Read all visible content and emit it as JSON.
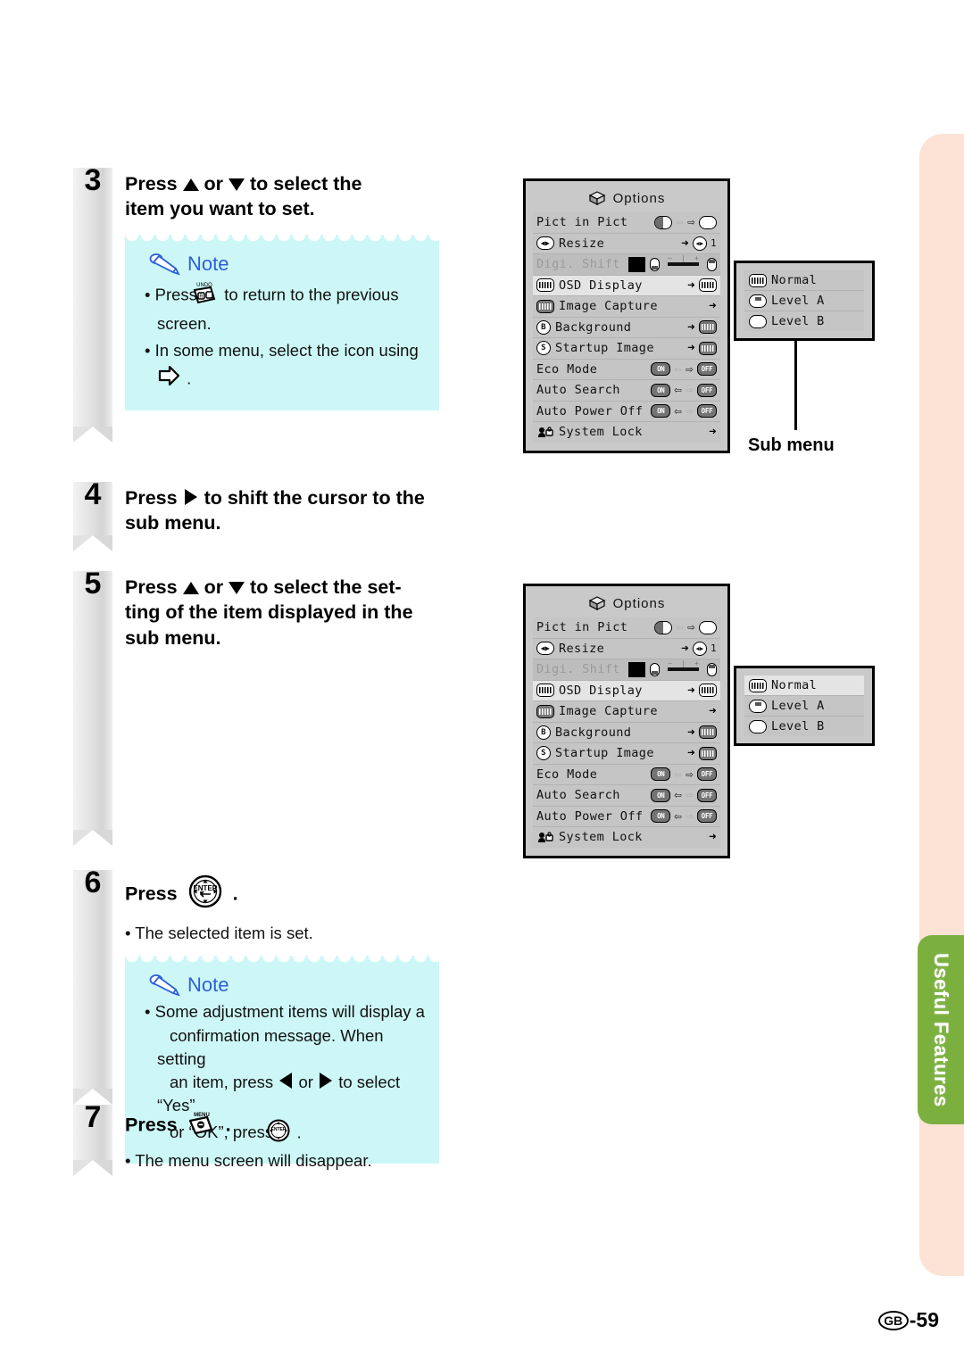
{
  "page": {
    "number_prefix": "GB",
    "number": "-59",
    "chapter_tab": "Useful Features"
  },
  "steps": [
    {
      "num": "3",
      "title_parts": [
        "Press ",
        " or ",
        " to select the item you want to set."
      ],
      "title_plain": "Press ▲ or ▼ to select the item you want to set.",
      "note": {
        "label": "Note",
        "items": [
          "Press  to return to the previous screen.",
          "In some menu, select the icon using  ."
        ],
        "item1_pre": "Press",
        "item1_post": "to return to the previous screen.",
        "item2_pre": "In some menu, select the icon using",
        "item2_post": "."
      }
    },
    {
      "num": "4",
      "title_plain": "Press ▶ to shift the cursor to the sub menu.",
      "title_pre": "Press",
      "title_post": "to shift the cursor to the sub menu."
    },
    {
      "num": "5",
      "title_plain": "Press ▲ or ▼ to select the setting of the item displayed in the sub menu.",
      "title_pre": "Press",
      "title_mid": "or",
      "title_post": "to select the set-ting of the item displayed in the sub menu.",
      "title_line1": "to select the set-",
      "title_line2": "ting of the item displayed in the",
      "title_line3": "sub menu."
    },
    {
      "num": "6",
      "title_pre": "Press",
      "title_post": ".",
      "bullet": "The selected item is set.",
      "note": {
        "label": "Note",
        "text_a": "Some adjustment items will display a",
        "text_b": "confirmation message. When setting",
        "text_c": "an item, press",
        "text_d": "or",
        "text_e": "to select “Yes”",
        "text_f": "or “OK”, press",
        "text_g": "."
      }
    },
    {
      "num": "7",
      "title_pre": "Press",
      "title_post": ".",
      "bullet": "The menu screen will disappear."
    }
  ],
  "osd_menus": [
    {
      "id": "menu-top",
      "title": "Options",
      "rows": [
        {
          "label": "Pict in Pict",
          "state": "normal",
          "icon": null,
          "control": "pip"
        },
        {
          "label": "Resize",
          "state": "normal",
          "icon": "resize-icon",
          "control": "arrow-value",
          "value": "1"
        },
        {
          "label": "Digi. Shift",
          "state": "dim",
          "icon": null,
          "control": "slider"
        },
        {
          "label": "OSD Display",
          "state": "selected",
          "icon": "osd-icon",
          "control": "arrow-chip"
        },
        {
          "label": "Image Capture",
          "state": "normal",
          "icon": "capture-icon",
          "control": "arrow"
        },
        {
          "label": "Background",
          "state": "normal",
          "icon": "B",
          "control": "arrow-chip"
        },
        {
          "label": "Startup Image",
          "state": "normal",
          "icon": "S",
          "control": "arrow-chip"
        },
        {
          "label": "Eco Mode",
          "state": "normal",
          "icon": null,
          "control": "onoff",
          "on": "ON",
          "off": "OFF",
          "dir": "right"
        },
        {
          "label": "Auto Search",
          "state": "normal",
          "icon": null,
          "control": "onoff",
          "on": "ON",
          "off": "OFF",
          "dir": "left"
        },
        {
          "label": "Auto Power Off",
          "state": "normal",
          "icon": null,
          "control": "onoff",
          "on": "ON",
          "off": "OFF",
          "dir": "left"
        },
        {
          "label": "System Lock",
          "state": "normal",
          "icon": "lock-icon",
          "control": "arrow"
        }
      ]
    },
    {
      "id": "menu-bottom",
      "title": "Options",
      "rows": [
        {
          "label": "Pict in Pict",
          "state": "normal",
          "icon": null,
          "control": "pip"
        },
        {
          "label": "Resize",
          "state": "normal",
          "icon": "resize-icon",
          "control": "arrow-value",
          "value": "1"
        },
        {
          "label": "Digi. Shift",
          "state": "dim",
          "icon": null,
          "control": "slider"
        },
        {
          "label": "OSD Display",
          "state": "selected",
          "icon": "osd-icon",
          "control": "arrow-chip"
        },
        {
          "label": "Image Capture",
          "state": "normal",
          "icon": "capture-icon",
          "control": "arrow"
        },
        {
          "label": "Background",
          "state": "normal",
          "icon": "B",
          "control": "arrow-chip"
        },
        {
          "label": "Startup Image",
          "state": "normal",
          "icon": "S",
          "control": "arrow-chip"
        },
        {
          "label": "Eco Mode",
          "state": "normal",
          "icon": null,
          "control": "onoff",
          "on": "ON",
          "off": "OFF",
          "dir": "right"
        },
        {
          "label": "Auto Search",
          "state": "normal",
          "icon": null,
          "control": "onoff",
          "on": "ON",
          "off": "OFF",
          "dir": "left"
        },
        {
          "label": "Auto Power Off",
          "state": "normal",
          "icon": null,
          "control": "onoff",
          "on": "ON",
          "off": "OFF",
          "dir": "left"
        },
        {
          "label": "System Lock",
          "state": "normal",
          "icon": "lock-icon",
          "control": "arrow"
        }
      ]
    }
  ],
  "submenus": [
    {
      "id": "submenu-top",
      "caption": "Sub menu",
      "rows": [
        {
          "label": "Normal",
          "selected": false
        },
        {
          "label": "Level A",
          "selected": false
        },
        {
          "label": "Level B",
          "selected": false
        }
      ]
    },
    {
      "id": "submenu-bottom",
      "rows": [
        {
          "label": "Normal",
          "selected": true
        },
        {
          "label": "Level A",
          "selected": false
        },
        {
          "label": "Level B",
          "selected": false
        }
      ]
    }
  ],
  "colors": {
    "note_bg": "#cdf7f7",
    "note_accent": "#2b5fd9",
    "tab_green": "#7bb03f",
    "strip_peach": "#fce3d5",
    "osd_bg": "#c9c9c9"
  }
}
